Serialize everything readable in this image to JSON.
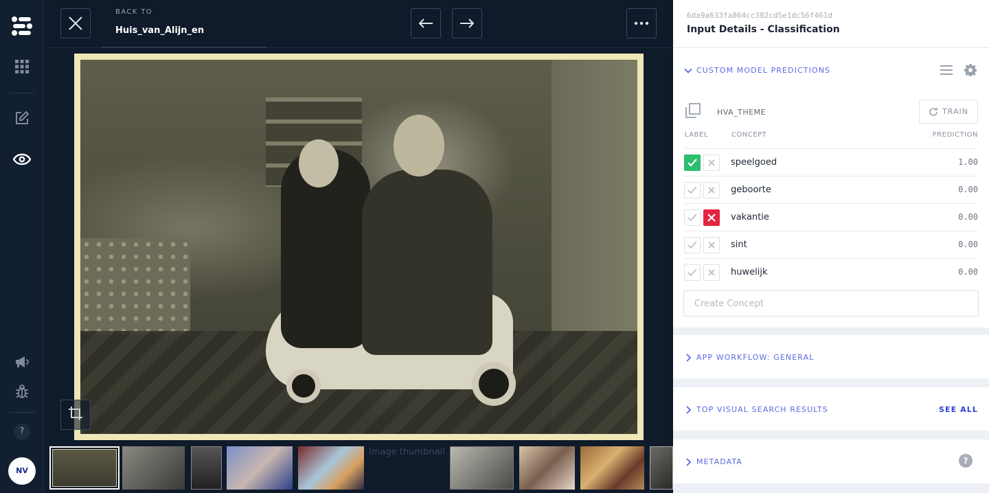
{
  "rail": {
    "icons": [
      "clarifai-logo-icon",
      "apps-grid-icon",
      "edit-icon",
      "eye-icon",
      "megaphone-icon",
      "bug-icon"
    ],
    "help_label": "?",
    "avatar_initials": "NV"
  },
  "topbar": {
    "back_to_label": "BACK TO",
    "back_title": "Huis_van_Alijn_en"
  },
  "thumbnails": {
    "alt_text": "Image thumbnail"
  },
  "panel": {
    "input_id": "6da9a633fa864cc382cd5e1dc56f461d",
    "title": "Input Details - Classification",
    "custom_model": {
      "heading": "CUSTOM MODEL PREDICTIONS",
      "model_name": "HVA_THEME",
      "train_label": "TRAIN",
      "columns": {
        "label": "LABEL",
        "concept": "CONCEPT",
        "prediction": "PREDICTION"
      },
      "rows": [
        {
          "concept": "speelgoed",
          "prediction": "1.00",
          "state": "positive"
        },
        {
          "concept": "geboorte",
          "prediction": "0.00",
          "state": "none"
        },
        {
          "concept": "vakantie",
          "prediction": "0.00",
          "state": "negative"
        },
        {
          "concept": "sint",
          "prediction": "0.00",
          "state": "none"
        },
        {
          "concept": "huwelijk",
          "prediction": "0.00",
          "state": "none"
        }
      ],
      "create_placeholder": "Create Concept"
    },
    "app_workflow": {
      "heading": "APP WORKFLOW: GENERAL"
    },
    "visual_search": {
      "heading": "TOP VISUAL SEARCH RESULTS",
      "see_all": "SEE ALL"
    },
    "metadata": {
      "heading": "METADATA",
      "help_label": "?"
    }
  },
  "colors": {
    "accent": "#5a68e0",
    "positive": "#2dbd6e",
    "negative": "#e5243f",
    "rail_bg": "#121f30"
  }
}
